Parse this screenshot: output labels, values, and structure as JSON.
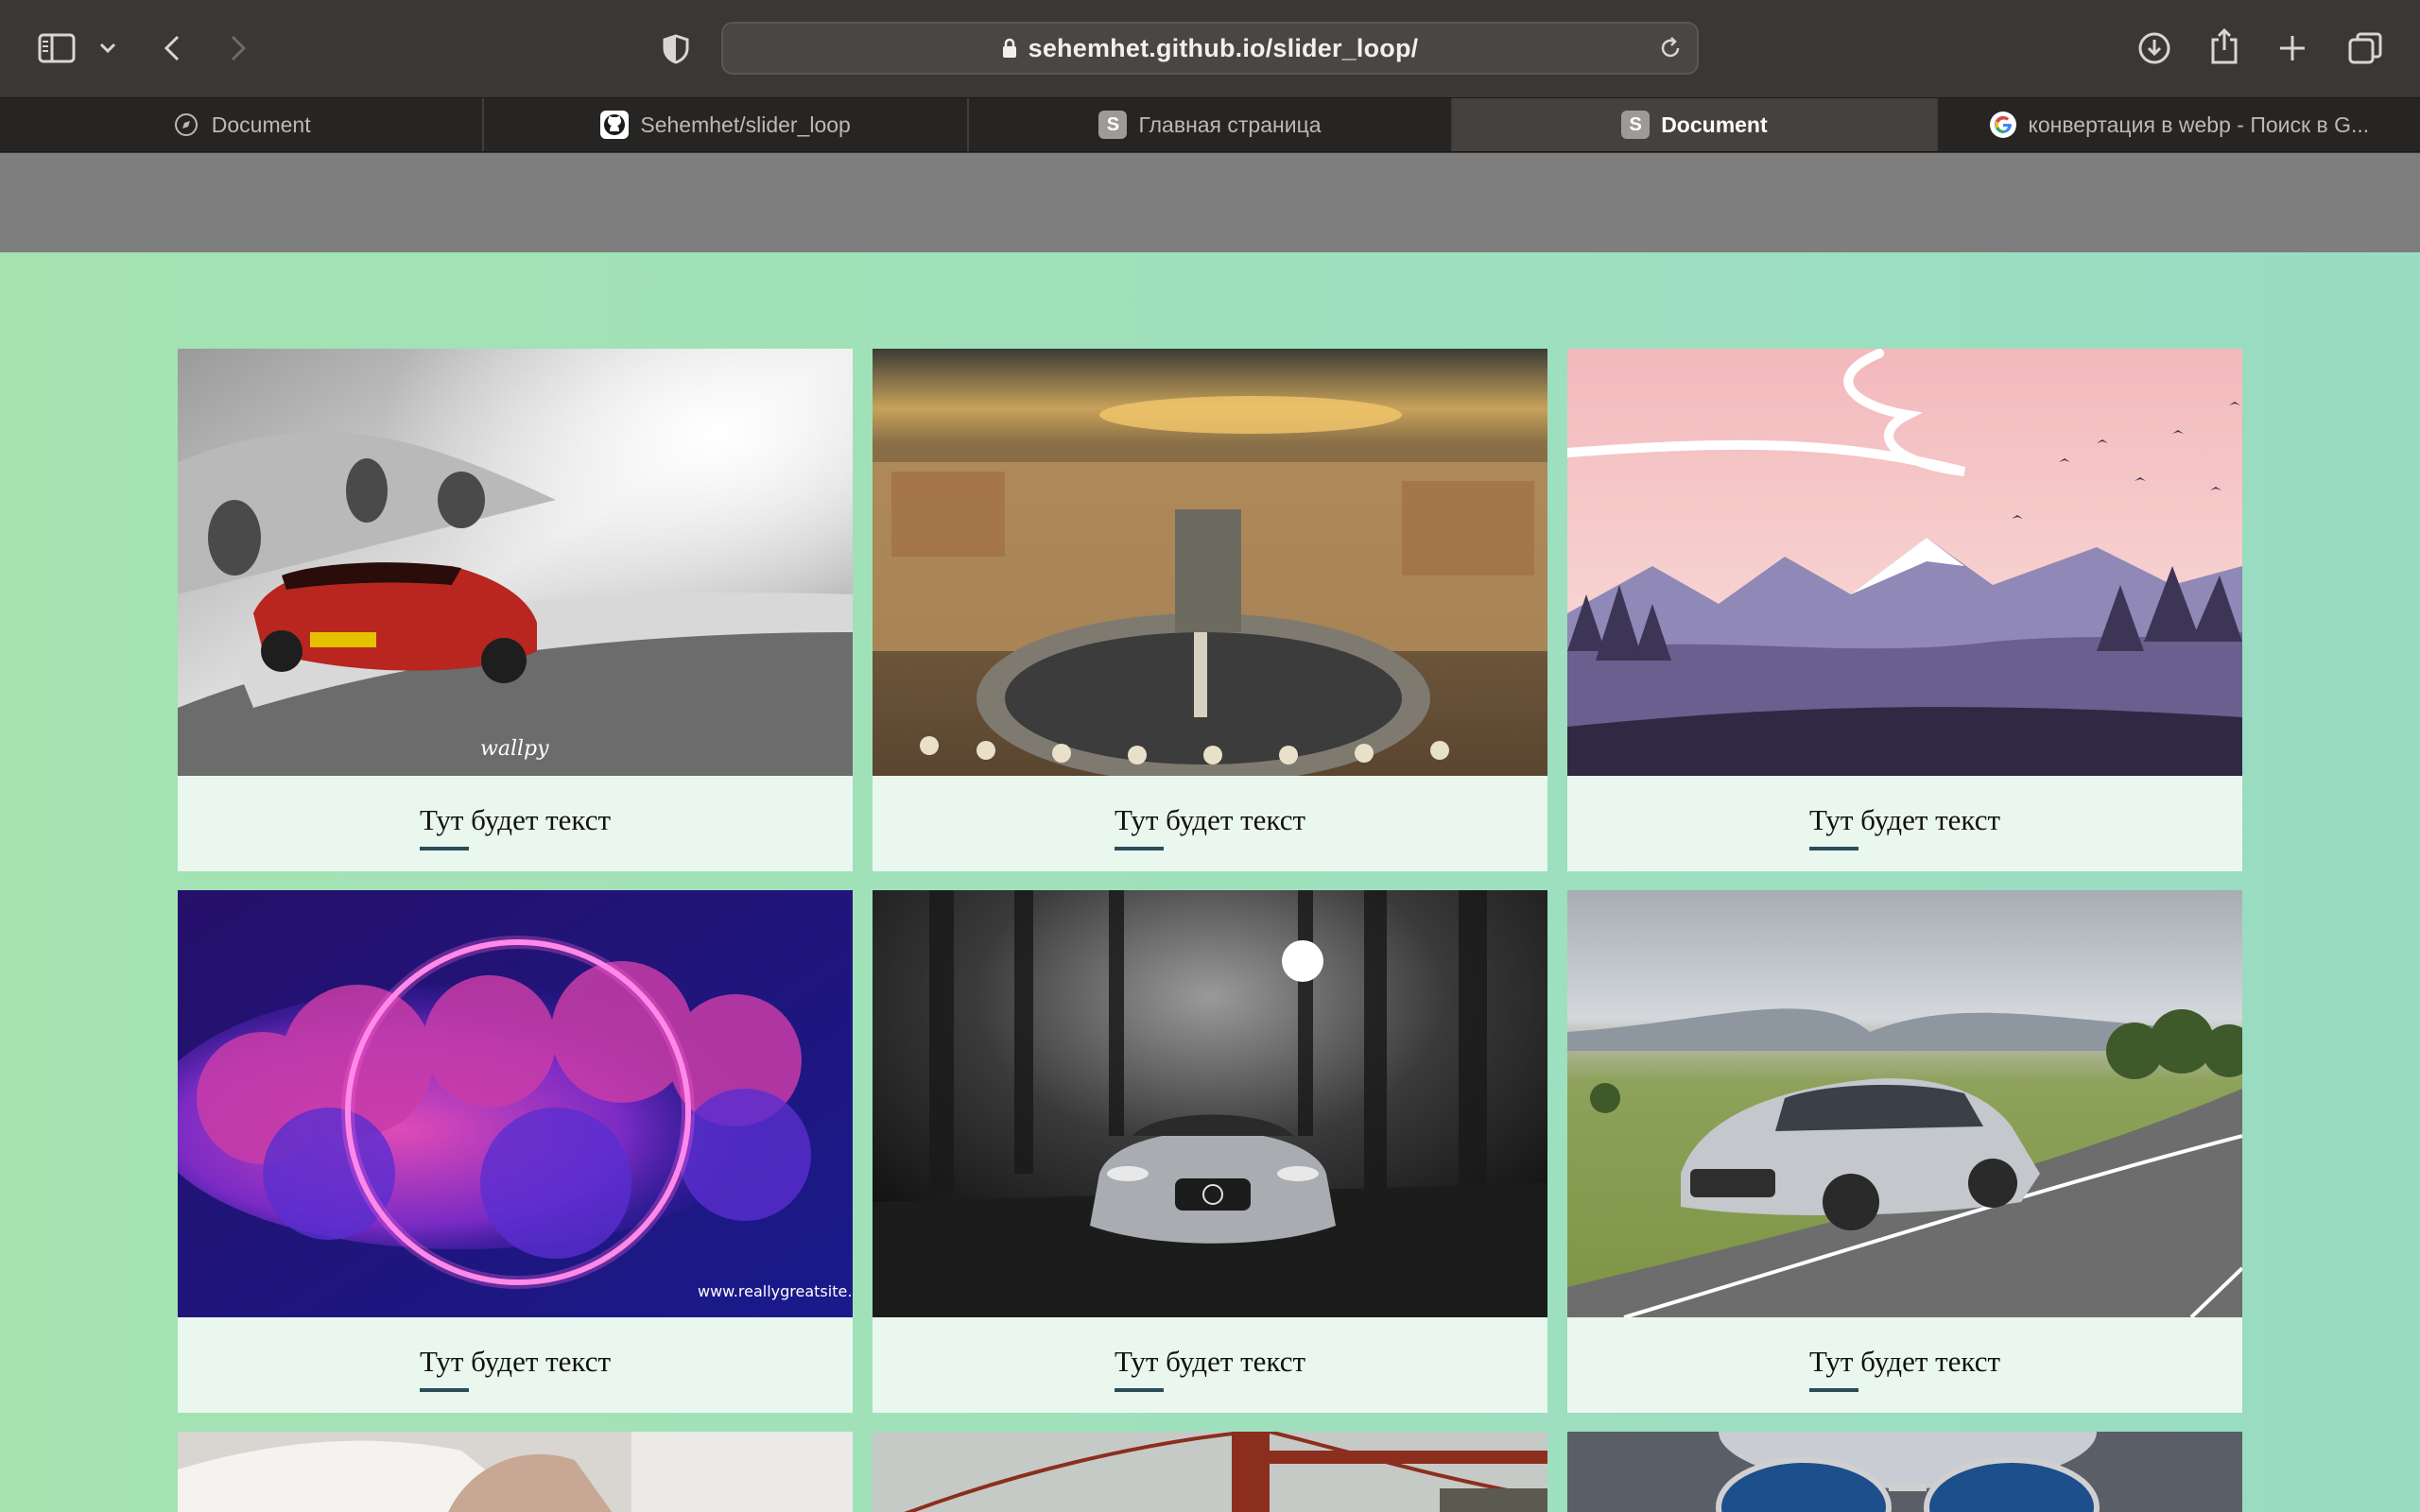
{
  "browser": {
    "url": "sehemhet.github.io/slider_loop/",
    "tabs": [
      {
        "label": "Document",
        "icon": "compass-icon",
        "active": false
      },
      {
        "label": "Sehemhet/slider_loop",
        "icon": "github-icon",
        "active": false
      },
      {
        "label": "Главная страница",
        "icon": "s-badge-icon",
        "badge": "S",
        "active": false
      },
      {
        "label": "Document",
        "icon": "s-badge-icon",
        "badge": "S",
        "active": true
      },
      {
        "label": "конвертация в webp - Поиск в G...",
        "icon": "google-icon",
        "active": false
      }
    ]
  },
  "gallery": {
    "cards": [
      {
        "caption": "Тут будет текст",
        "image": "red sports car drifting on snowy road",
        "watermark": "wallpy"
      },
      {
        "caption": "Тут будет текст",
        "image": "aerial view of Saint Peter's Square at sunset"
      },
      {
        "caption": "Тут будет текст",
        "image": "pink sky over purple mountains with birds"
      },
      {
        "caption": "Тут будет текст",
        "image": "neon ring over pink and purple clouds",
        "watermark": "www.reallygreatsite.c"
      },
      {
        "caption": "Тут будет текст",
        "image": "silver sports car in dark forest"
      },
      {
        "caption": "Тут будет текст",
        "image": "silver sedan on countryside road"
      }
    ],
    "partial_row": [
      {
        "image": "person in white shirt"
      },
      {
        "image": "red suspension bridge in fog"
      },
      {
        "image": "sunglasses under cloudy sky"
      }
    ]
  },
  "colors": {
    "page_gradient_start": "#a4e3b0",
    "page_gradient_end": "#98dcc3",
    "card_bg": "#e9f7ef",
    "caption_underline": "#2a4d57"
  }
}
